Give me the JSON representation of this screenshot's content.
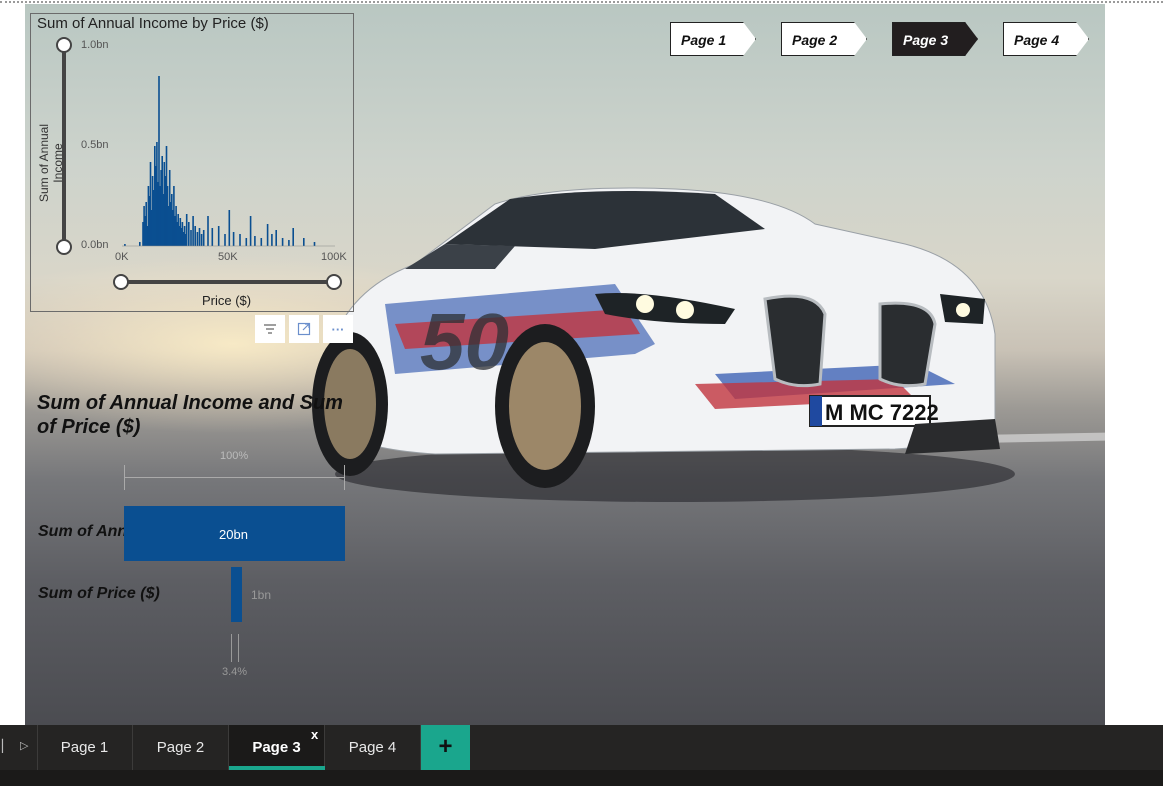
{
  "nav_buttons": [
    {
      "label": "Page 1",
      "active": false
    },
    {
      "label": "Page 2",
      "active": false
    },
    {
      "label": "Page 3",
      "active": true
    },
    {
      "label": "Page 4",
      "active": false
    }
  ],
  "histogram": {
    "title": "Sum of Annual Income by Price ($)",
    "ylabel": "Sum of Annual Income",
    "xlabel": "Price ($)",
    "yticks": [
      "1.0bn",
      "0.5bn",
      "0.0bn"
    ],
    "xticks": [
      "0K",
      "50K",
      "100K"
    ],
    "bar_color": "#0a4f91"
  },
  "visual_toolbar": {
    "filter_icon": "filter-icon",
    "focus_icon": "focus-mode-icon",
    "more_icon": "more-options-icon",
    "more_label": "···"
  },
  "gauge": {
    "title": "Sum of Annual Income and Sum of Price ($)",
    "pct_top": "100%",
    "bar1_label": "Sum of Annual...",
    "bar1_value": "20bn",
    "bar2_label": "Sum of Price ($)",
    "bar2_value": "1bn",
    "pct_bottom": "3.4%"
  },
  "tabs": [
    {
      "label": "Page 1",
      "active": false
    },
    {
      "label": "Page 2",
      "active": false
    },
    {
      "label": "Page 3",
      "active": true
    },
    {
      "label": "Page 4",
      "active": false
    }
  ],
  "tab_close": "x",
  "add_tab": "+",
  "license_plate": "M MC 7222",
  "car_number": "50",
  "chart_data": [
    {
      "type": "bar",
      "title": "Sum of Annual Income by Price ($)",
      "xlabel": "Price ($)",
      "ylabel": "Sum of Annual Income",
      "xlim": [
        0,
        100000
      ],
      "ylim": [
        0,
        1000000000
      ],
      "x": [
        1000,
        8000,
        9500,
        10000,
        10500,
        11000,
        11500,
        12000,
        12500,
        13000,
        13500,
        14000,
        14500,
        15000,
        15500,
        16000,
        16500,
        17000,
        17500,
        18000,
        18500,
        19000,
        19500,
        20000,
        20500,
        21000,
        21500,
        22000,
        22500,
        23000,
        23500,
        24000,
        24500,
        25000,
        25500,
        26000,
        26500,
        27000,
        27500,
        28000,
        28500,
        29000,
        29500,
        30000,
        31000,
        32000,
        33000,
        34000,
        35000,
        36000,
        37000,
        38000,
        40000,
        42000,
        45000,
        48000,
        50000,
        52000,
        55000,
        58000,
        60000,
        62000,
        65000,
        68000,
        70000,
        72000,
        75000,
        78000,
        80000,
        85000,
        90000
      ],
      "values": [
        10000000,
        20000000,
        120000000,
        200000000,
        150000000,
        220000000,
        100000000,
        300000000,
        250000000,
        420000000,
        180000000,
        350000000,
        280000000,
        500000000,
        400000000,
        520000000,
        320000000,
        850000000,
        300000000,
        380000000,
        450000000,
        260000000,
        420000000,
        350000000,
        500000000,
        300000000,
        200000000,
        380000000,
        220000000,
        260000000,
        180000000,
        300000000,
        150000000,
        200000000,
        120000000,
        160000000,
        100000000,
        140000000,
        90000000,
        120000000,
        70000000,
        100000000,
        60000000,
        160000000,
        120000000,
        80000000,
        150000000,
        100000000,
        70000000,
        90000000,
        60000000,
        80000000,
        150000000,
        90000000,
        100000000,
        60000000,
        180000000,
        70000000,
        60000000,
        40000000,
        150000000,
        50000000,
        40000000,
        110000000,
        60000000,
        80000000,
        40000000,
        30000000,
        90000000,
        40000000,
        20000000
      ]
    },
    {
      "type": "bar",
      "title": "Sum of Annual Income and Sum of Price ($)",
      "categories": [
        "Sum of Annual...",
        "Sum of Price ($)"
      ],
      "values": [
        20000000000,
        1000000000
      ],
      "percent_labels": [
        "100%",
        "3.4%"
      ]
    }
  ]
}
